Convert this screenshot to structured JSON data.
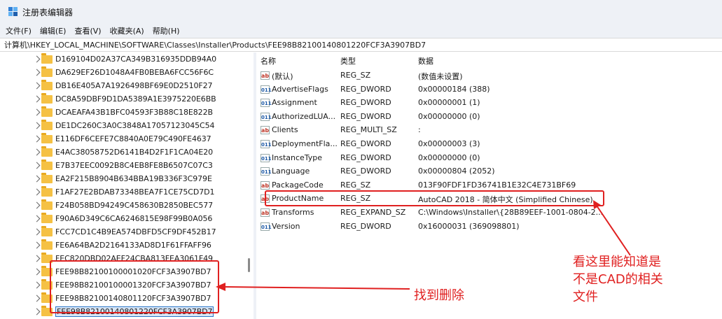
{
  "window": {
    "title": "注册表编辑器"
  },
  "menu": [
    {
      "label": "文件(F)"
    },
    {
      "label": "编辑(E)"
    },
    {
      "label": "查看(V)"
    },
    {
      "label": "收藏夹(A)"
    },
    {
      "label": "帮助(H)"
    }
  ],
  "address": {
    "path": "计算机\\HKEY_LOCAL_MACHINE\\SOFTWARE\\Classes\\Installer\\Products\\FEE98B82100140801220FCF3A3907BD7"
  },
  "tree": {
    "items": [
      {
        "label": "D169104D02A37CA349B316935DDB94A0"
      },
      {
        "label": "DA629EF26D1048A4FB0BEBA6FCC56F6C"
      },
      {
        "label": "DB16E405A7A1926498BF69E0D2510F27"
      },
      {
        "label": "DC8A59DBF9D1DA5389A1E3975220E6BB"
      },
      {
        "label": "DCAEAFA43B1BFC04593F3B88C18E822B"
      },
      {
        "label": "DE1DC260C3A0C3848A17057123045C54"
      },
      {
        "label": "E116DF6CEFE7C8840A0E79C490FE4637"
      },
      {
        "label": "E4AC38058752D6141B4D2F1F1CA04E20"
      },
      {
        "label": "E7B37EEC0092B8C4EB8FE8B6507C07C3"
      },
      {
        "label": "EA2F215B8904B634BBA19B336F3C979E"
      },
      {
        "label": "F1AF27E2BDAB73348BEA7F1CE75CD7D1"
      },
      {
        "label": "F24B058BD94249C458630B2850BEC577"
      },
      {
        "label": "F90A6D349C6CA6246815E98F99B0A056"
      },
      {
        "label": "FCC7CD1C4B9EA574DBFD5CF9DF452B17"
      },
      {
        "label": "FE6A64BA2D2164133AD8D1F61FFAFF96"
      },
      {
        "label": "FEC820DBD02AEF24CBA813FEA3061F49"
      },
      {
        "label": "FEE98B82100100001020FCF3A3907BD7"
      },
      {
        "label": "FEE98B82100100001320FCF3A3907BD7"
      },
      {
        "label": "FEE98B82100140801120FCF3A3907BD7"
      },
      {
        "label": "FEE98B82100140801220FCF3A3907BD7",
        "selected": true
      }
    ]
  },
  "values": {
    "headers": {
      "name": "名称",
      "type": "类型",
      "data": "数据"
    },
    "rows": [
      {
        "icon": "string-value-icon",
        "name": "(默认)",
        "type": "REG_SZ",
        "data": "(数值未设置)"
      },
      {
        "icon": "binary-value-icon",
        "name": "AdvertiseFlags",
        "type": "REG_DWORD",
        "data": "0x00000184 (388)"
      },
      {
        "icon": "binary-value-icon",
        "name": "Assignment",
        "type": "REG_DWORD",
        "data": "0x00000001 (1)"
      },
      {
        "icon": "binary-value-icon",
        "name": "AuthorizedLUA...",
        "type": "REG_DWORD",
        "data": "0x00000000 (0)"
      },
      {
        "icon": "string-value-icon",
        "name": "Clients",
        "type": "REG_MULTI_SZ",
        "data": ":"
      },
      {
        "icon": "binary-value-icon",
        "name": "DeploymentFla...",
        "type": "REG_DWORD",
        "data": "0x00000003 (3)"
      },
      {
        "icon": "binary-value-icon",
        "name": "InstanceType",
        "type": "REG_DWORD",
        "data": "0x00000000 (0)"
      },
      {
        "icon": "binary-value-icon",
        "name": "Language",
        "type": "REG_DWORD",
        "data": "0x00000804 (2052)"
      },
      {
        "icon": "string-value-icon",
        "name": "PackageCode",
        "type": "REG_SZ",
        "data": "013F90FDF1FD36741B1E32C4E731BF69"
      },
      {
        "icon": "string-value-icon",
        "name": "ProductName",
        "type": "REG_SZ",
        "data": "AutoCAD 2018 - 简体中文 (Simplified Chinese)"
      },
      {
        "icon": "string-value-icon",
        "name": "Transforms",
        "type": "REG_EXPAND_SZ",
        "data": "C:\\Windows\\Installer\\{28B89EEF-1001-0804-2..."
      },
      {
        "icon": "binary-value-icon",
        "name": "Version",
        "type": "REG_DWORD",
        "data": "0x16000031 (369098801)"
      }
    ]
  },
  "annotations": {
    "find_delete": "找到删除",
    "cad_line1": "看这里能知道是",
    "cad_line2": "不是CAD的相关",
    "cad_line3": "文件",
    "color": "#e02020"
  }
}
